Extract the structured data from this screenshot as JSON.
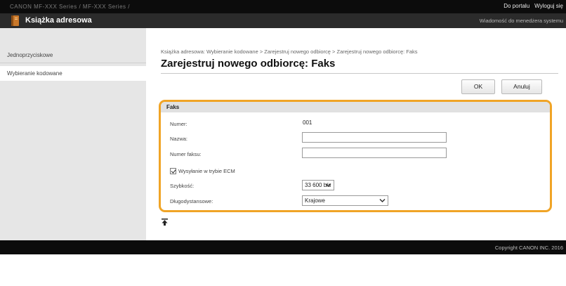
{
  "topbar": {
    "device_name": "CANON  MF-XXX Series / MF-XXX Series /",
    "portal_link": "Do portalu",
    "logout_link": "Wyloguj się"
  },
  "header": {
    "title": "Książka adresowa",
    "message_link": "Wiadomość do menedżera systemu",
    "icon": "address-book-icon"
  },
  "sidebar": {
    "items": [
      {
        "label": "Jednoprzyciskowe",
        "active": false
      },
      {
        "label": "Wybieranie kodowane",
        "active": true
      }
    ]
  },
  "breadcrumb": "Książka adresowa: Wybieranie kodowane > Zarejestruj nowego odbiorcę > Zarejestruj nowego odbiorcę: Faks",
  "page_title": "Zarejestruj nowego odbiorcę: Faks",
  "buttons": {
    "ok": "OK",
    "cancel": "Anuluj"
  },
  "fax_group": {
    "heading": "Faks",
    "number": {
      "label": "Numer:",
      "value": "001"
    },
    "name": {
      "label": "Nazwa:",
      "value": ""
    },
    "fax_number": {
      "label": "Numer faksu:",
      "value": ""
    },
    "ecm": {
      "label": "Wysyłanie w trybie ECM",
      "checked": true
    },
    "speed": {
      "label": "Szybkość:",
      "value": "33 600 b/s"
    },
    "long_distance": {
      "label": "Długodystansowe:",
      "value": "Krajowe"
    },
    "accent_color": "#f0a426"
  },
  "footer": {
    "copyright": "Copyright CANON INC. 2016"
  }
}
